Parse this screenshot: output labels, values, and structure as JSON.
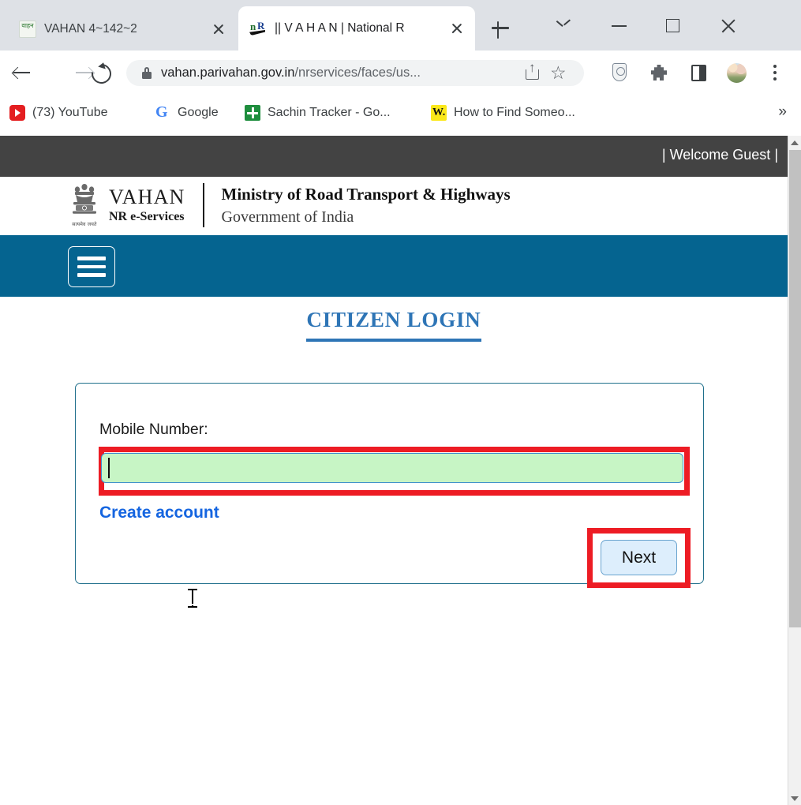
{
  "browser": {
    "tabs": [
      {
        "title": "VAHAN 4~142~2",
        "favicon": "vahan-devanagari-icon",
        "active": false,
        "close_label": "close-tab"
      },
      {
        "title": "|| V A H A N | National R",
        "favicon": "vahan-nr-icon",
        "active": true,
        "close_label": "close-tab"
      }
    ],
    "new_tab_label": "+",
    "window_controls": {
      "tab_search": "chevron-down-icon",
      "minimize": "minimize-icon",
      "maximize": "maximize-icon",
      "close": "close-icon"
    },
    "toolbar": {
      "back": "back-arrow-icon",
      "forward": "forward-arrow-icon",
      "reload": "reload-icon",
      "site_security": "lock-icon",
      "url_host": "vahan.parivahan.gov.in",
      "url_path": "/nrservices/faces/us...",
      "url_full": "vahan.parivahan.gov.in/nrservices/faces/us...",
      "share": "share-icon",
      "bookmark": "star-icon",
      "shield": "shield-icon",
      "extensions": "puzzle-icon",
      "side_panel": "side-panel-icon",
      "profile": "avatar-icon",
      "menu": "three-dot-menu-icon"
    },
    "bookmarks": [
      {
        "label": "(73) YouTube",
        "icon": "youtube-icon"
      },
      {
        "label": "Google",
        "icon": "google-icon"
      },
      {
        "label": "Sachin Tracker - Go...",
        "icon": "google-sheets-icon"
      },
      {
        "label": "How to Find Someo...",
        "icon": "w-yellow-icon"
      }
    ],
    "bookmarks_overflow": "»"
  },
  "page": {
    "topbar": {
      "welcome_text": "| Welcome Guest |"
    },
    "brand": {
      "emblem_caption": "सत्यमेव जयते",
      "name": "VAHAN",
      "subname": "NR e-Services",
      "ministry_line1": "Ministry of Road Transport & Highways",
      "ministry_line2": "Government of India"
    },
    "navbar": {
      "menu_button": "hamburger-menu"
    },
    "login": {
      "heading": "CITIZEN LOGIN",
      "mobile_label": "Mobile Number:",
      "mobile_value": "",
      "mobile_placeholder": "",
      "create_account": "Create account",
      "next_button": "Next"
    },
    "colors": {
      "navbar_teal": "#056490",
      "topbar_dark": "#434343",
      "heading_blue": "#2e75b6",
      "link_blue": "#1565e0",
      "input_green": "#c7f5c5",
      "input_border_blue": "#3e8fcc",
      "highlight_red": "#ed1c24",
      "button_blue": "#ddeefc"
    }
  }
}
